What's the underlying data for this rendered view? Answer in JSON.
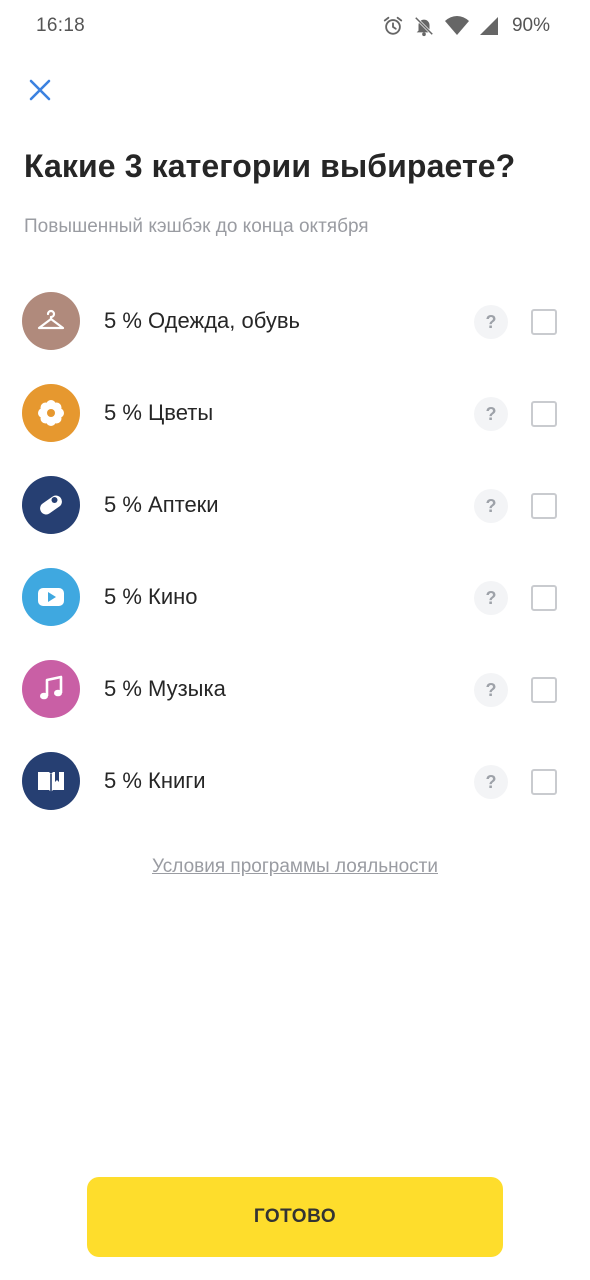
{
  "status_bar": {
    "time": "16:18",
    "battery": "90%",
    "icons": [
      "alarm-icon",
      "bell-off-icon",
      "wifi-icon",
      "signal-icon"
    ]
  },
  "header": {
    "close_icon": "close-icon",
    "title": "Какие 3 категории выбираете?",
    "subtitle": "Повышенный кэшбэк до конца октября"
  },
  "categories": [
    {
      "label": "5 % Одежда, обувь",
      "icon": "hanger-icon",
      "color": "#b08a7c",
      "help": "?",
      "checked": false
    },
    {
      "label": "5 % Цветы",
      "icon": "flower-icon",
      "color": "#e6982f",
      "help": "?",
      "checked": false
    },
    {
      "label": "5 % Аптеки",
      "icon": "pill-icon",
      "color": "#263f72",
      "help": "?",
      "checked": false
    },
    {
      "label": "5 % Кино",
      "icon": "play-icon",
      "color": "#3fa8e0",
      "help": "?",
      "checked": false
    },
    {
      "label": "5 % Музыка",
      "icon": "music-note-icon",
      "color": "#c95fa5",
      "help": "?",
      "checked": false
    },
    {
      "label": "5 % Книги",
      "icon": "book-icon",
      "color": "#263f72",
      "help": "?",
      "checked": false
    }
  ],
  "footer": {
    "loyalty_link": "Условия программы лояльности",
    "done_label": "ГОТОВО"
  },
  "colors": {
    "accent": "#fedd2c",
    "close": "#3b82e0",
    "text_primary": "#262626",
    "text_secondary": "#9a9ca2"
  }
}
